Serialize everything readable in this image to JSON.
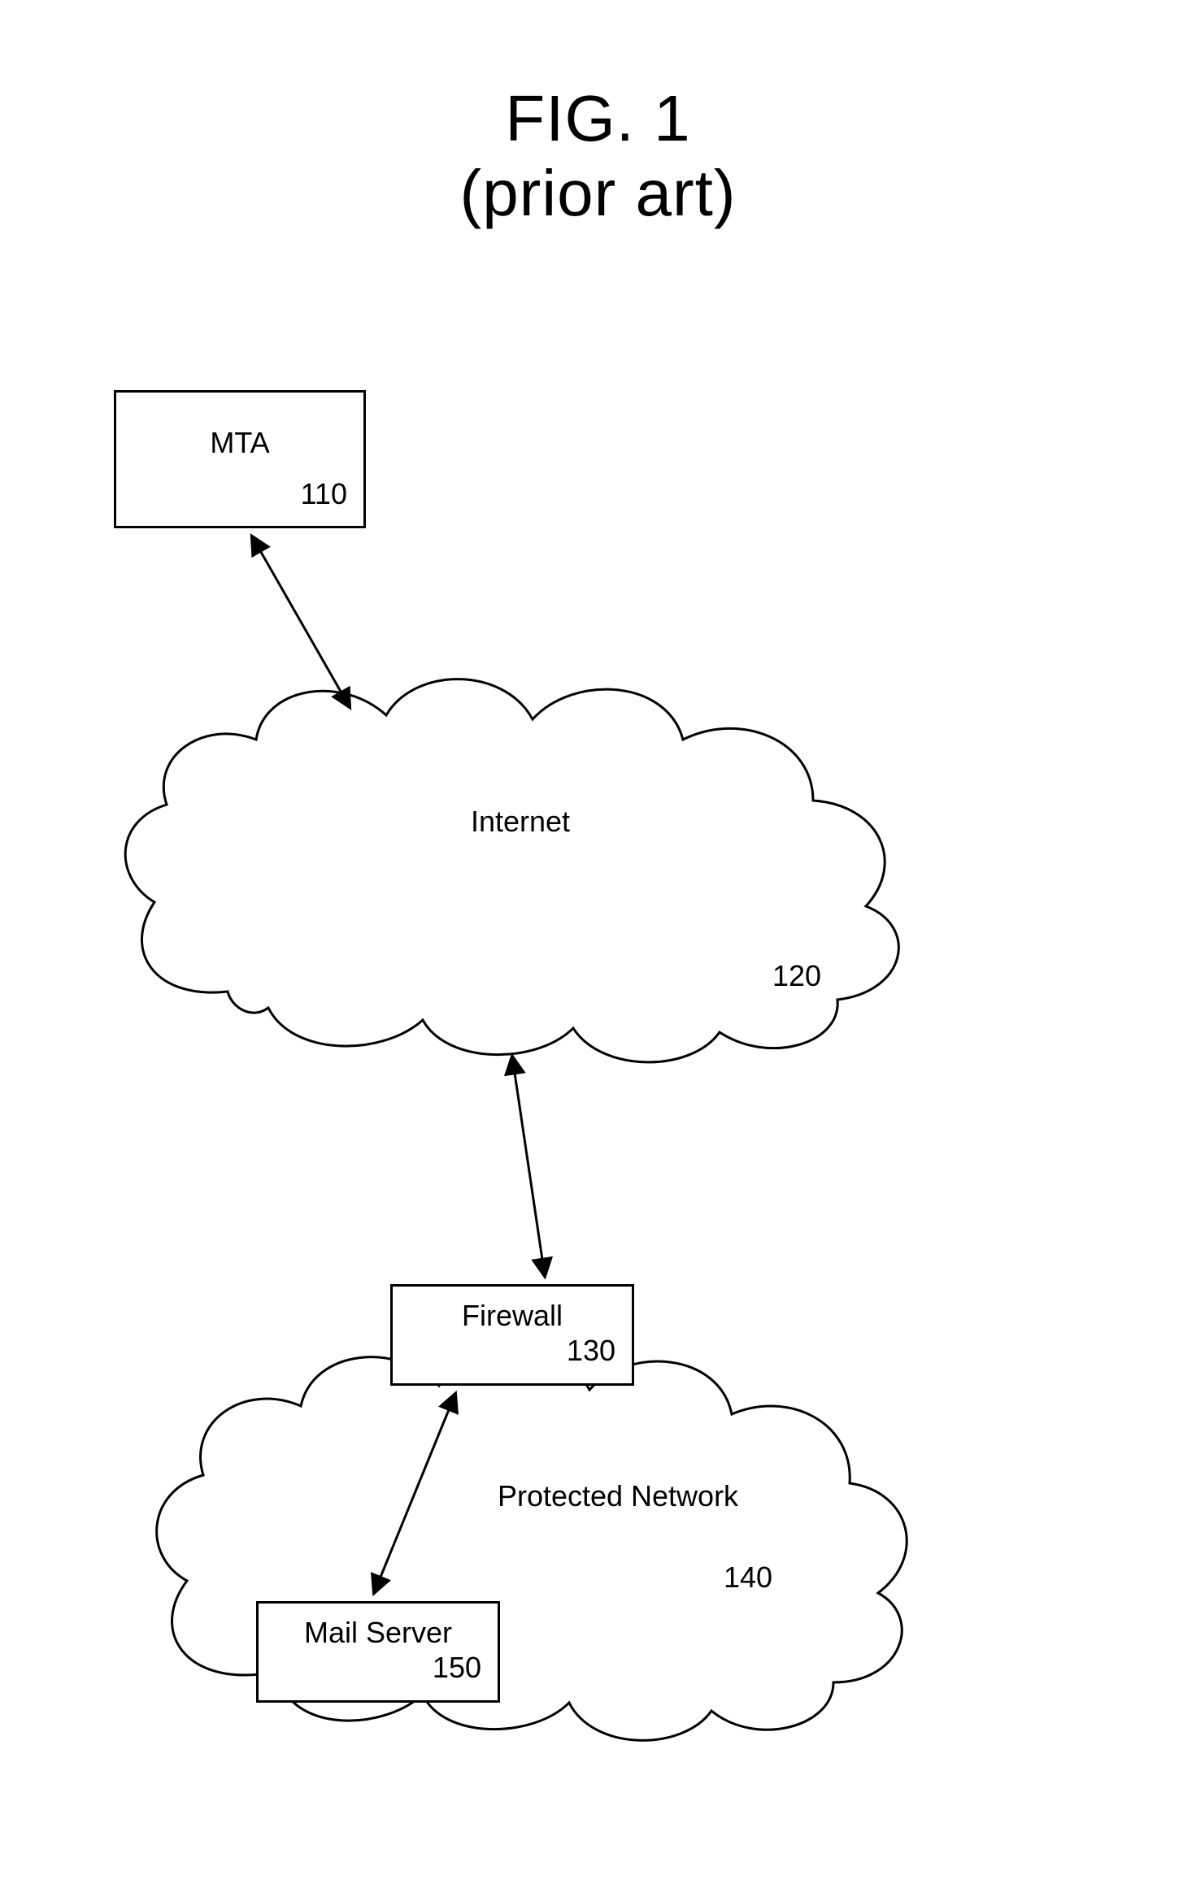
{
  "title": {
    "line1": "FIG. 1",
    "line2": "(prior art)"
  },
  "boxes": {
    "mta": {
      "label": "MTA",
      "ref": "110"
    },
    "firewall": {
      "label": "Firewall",
      "ref": "130"
    },
    "mailserver": {
      "label": "Mail Server",
      "ref": "150"
    }
  },
  "clouds": {
    "internet": {
      "label": "Internet",
      "ref": "120"
    },
    "protected": {
      "label": "Protected Network",
      "ref": "140"
    }
  }
}
